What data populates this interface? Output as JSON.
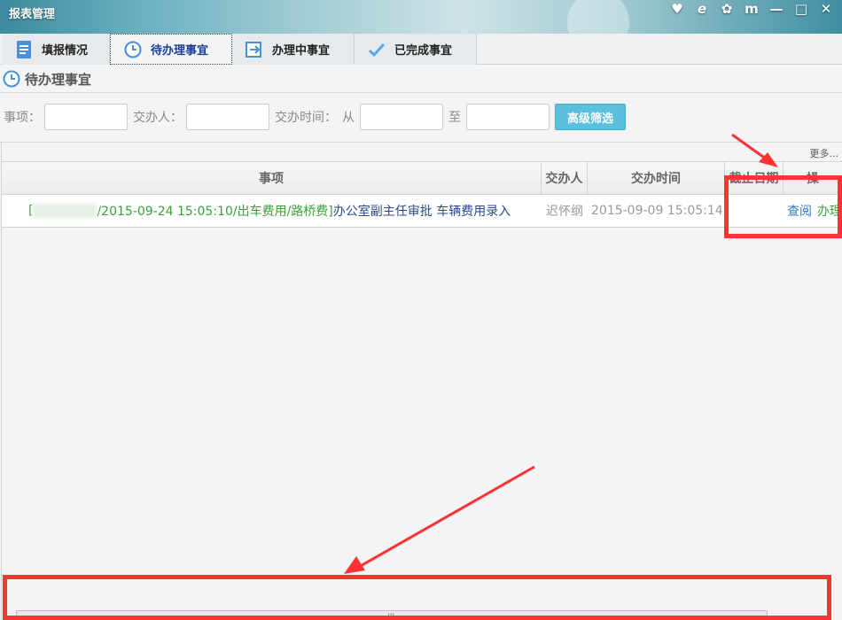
{
  "window": {
    "title": "报表管理",
    "controls": [
      "heart-icon",
      "ie-icon",
      "gear-icon",
      "book-icon",
      "minimize-icon",
      "maximize-icon",
      "close-icon"
    ]
  },
  "tabs": [
    {
      "label": "填报情况",
      "icon": "document-icon"
    },
    {
      "label": "待办理事宜",
      "icon": "clock-icon"
    },
    {
      "label": "办理中事宜",
      "icon": "forward-icon"
    },
    {
      "label": "已完成事宜",
      "icon": "check-icon"
    }
  ],
  "section": {
    "title": "待办理事宜"
  },
  "filters": {
    "item_label": "事项：",
    "assigner_label": "交办人：",
    "time_label": "交办时间：",
    "from_label": "从",
    "to_label": "至",
    "advanced_button": "高级筛选",
    "more_link": "更多..."
  },
  "table": {
    "headers": [
      "事项",
      "交办人",
      "交办时间",
      "截止日期",
      "操"
    ],
    "rows": [
      {
        "item_prefix": "[",
        "item_mid": "/2015-09-24 15:05:10/出车费用/路桥费]",
        "item_desc": " 办公室副主任审批 车辆费用录入",
        "assigner": "迟怀纲",
        "assigned_time": "2015-09-09 15:05:14",
        "deadline": "",
        "action_view": "查阅",
        "action_handle": "办理"
      }
    ]
  },
  "colors": {
    "accent": "#5bc0de",
    "annotation": "#ff3333",
    "green_text": "#3aa13a",
    "blue_text": "#2a4a8c"
  }
}
